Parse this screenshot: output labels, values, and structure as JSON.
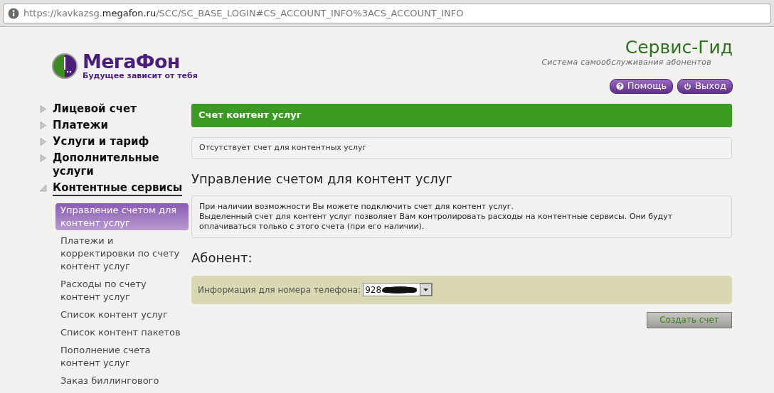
{
  "address_bar": {
    "url_host_prefix": "https://kavkazsg.",
    "url_domain": "megafon.ru",
    "url_path": "/SCC/SC_BASE_LOGIN#CS_ACCOUNT_INFO%3ACS_ACCOUNT_INFO"
  },
  "logo": {
    "name": "МегаФон",
    "slogan": "Будущее зависит от тебя"
  },
  "header": {
    "title": "Сервис-Гид",
    "subtitle": "Система самообслуживания абонентов",
    "buttons": [
      {
        "label": "Помощь",
        "kind": "help"
      },
      {
        "label": "Выход",
        "kind": "logout"
      }
    ]
  },
  "sidebar": {
    "items": [
      {
        "label": "Лицевой счет",
        "expanded": false
      },
      {
        "label": "Платежи",
        "expanded": false
      },
      {
        "label": "Услуги и тариф",
        "expanded": false
      },
      {
        "label": "Дополнительные услуги",
        "expanded": false
      },
      {
        "label": "Контентные сервисы",
        "expanded": true,
        "children": [
          {
            "label": "Управление счетом для контент услуг",
            "selected": true
          },
          {
            "label": "Платежи и корректировки по счету контент услуг",
            "selected": false
          },
          {
            "label": "Расходы по счету контент услуг",
            "selected": false
          },
          {
            "label": "Список контент услуг",
            "selected": false
          },
          {
            "label": "Список контент пакетов",
            "selected": false
          },
          {
            "label": "Пополнение счета контент услуг",
            "selected": false
          },
          {
            "label": "Заказ биллингового",
            "selected": false
          }
        ]
      }
    ]
  },
  "content": {
    "panel_title": "Счет контент услуг",
    "notice": "Отсутствует счет для контентных услуг",
    "section_title": "Управление счетом для контент услуг",
    "info_lines": [
      "При наличии возможности Вы можете подключить счет для контент услуг.",
      "Выделенный счет для контент услуг позволяет Вам контролировать расходы на контентные сервисы. Они будут оплачиваться только с этого счета (при его наличии)."
    ],
    "subscriber_title": "Абонент:",
    "phone_label": "Информация для номера телефона:",
    "phone_value": "928",
    "phone_redacted": true,
    "create_button": "Создать счет"
  }
}
